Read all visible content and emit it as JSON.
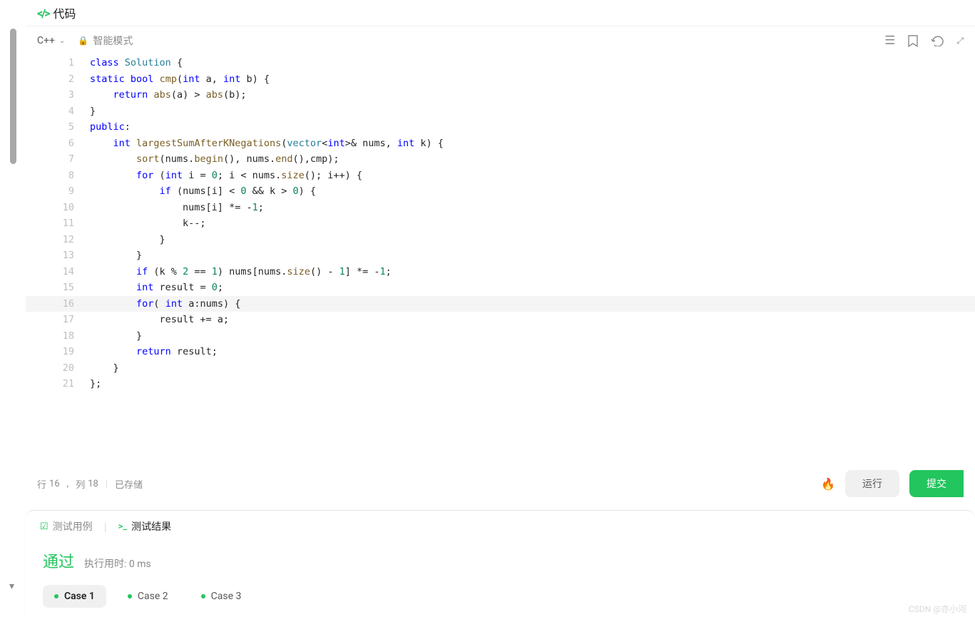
{
  "header": {
    "title": "代码"
  },
  "toolbar": {
    "language": "C++",
    "mode": "智能模式"
  },
  "code": {
    "lines": [
      {
        "n": 1,
        "html": "<span class='kw'>class</span> <span class='cls'>Solution</span> {"
      },
      {
        "n": 2,
        "html": "<span class='kw'>static</span> <span class='kw'>bool</span> <span class='fn'>cmp</span>(<span class='kw'>int</span> a, <span class='kw'>int</span> b) {"
      },
      {
        "n": 3,
        "html": "    <span class='kw'>return</span> <span class='fn'>abs</span>(a) > <span class='fn'>abs</span>(b);"
      },
      {
        "n": 4,
        "html": "}"
      },
      {
        "n": 5,
        "html": "<span class='kw'>public</span>:"
      },
      {
        "n": 6,
        "html": "    <span class='kw'>int</span> <span class='fn'>largestSumAfterKNegations</span>(<span class='type'>vector</span>&lt;<span class='kw'>int</span>&gt;&amp; nums, <span class='kw'>int</span> k) {"
      },
      {
        "n": 7,
        "html": "        <span class='fn'>sort</span>(nums.<span class='fn'>begin</span>(), nums.<span class='fn'>end</span>(),cmp);"
      },
      {
        "n": 8,
        "html": "        <span class='kw'>for</span> (<span class='kw'>int</span> i = <span class='num'>0</span>; i &lt; nums.<span class='fn'>size</span>(); i++) {"
      },
      {
        "n": 9,
        "html": "            <span class='kw'>if</span> (nums[i] &lt; <span class='num'>0</span> &amp;&amp; k &gt; <span class='num'>0</span>) {"
      },
      {
        "n": 10,
        "html": "                nums[i] *= -<span class='num'>1</span>;"
      },
      {
        "n": 11,
        "html": "                k--;"
      },
      {
        "n": 12,
        "html": "            }"
      },
      {
        "n": 13,
        "html": "        }"
      },
      {
        "n": 14,
        "html": "        <span class='kw'>if</span> (k % <span class='num'>2</span> == <span class='num'>1</span>) nums[nums.<span class='fn'>size</span>() - <span class='num'>1</span>] *= -<span class='num'>1</span>;"
      },
      {
        "n": 15,
        "html": "        <span class='kw'>int</span> result = <span class='num'>0</span>;"
      },
      {
        "n": 16,
        "html": "        <span class='kw'>for</span>( <span class='kw'>int</span> a:nums) {",
        "hl": true
      },
      {
        "n": 17,
        "html": "            result += a;"
      },
      {
        "n": 18,
        "html": "        }"
      },
      {
        "n": 19,
        "html": "        <span class='kw'>return</span> result;"
      },
      {
        "n": 20,
        "html": "    }"
      },
      {
        "n": 21,
        "html": "};"
      }
    ]
  },
  "status": {
    "cursor_row_label": "行",
    "cursor_row": 16,
    "cursor_col_label": "列",
    "cursor_col": 18,
    "saved": "已存储",
    "run": "运行",
    "submit": "提交"
  },
  "results": {
    "tabs": {
      "cases": "测试用例",
      "result": "测试结果"
    },
    "pass": "通过",
    "timing_label": "执行用时:",
    "timing_value": "0 ms",
    "cases": [
      {
        "label": "Case 1",
        "active": true
      },
      {
        "label": "Case 2"
      },
      {
        "label": "Case 3"
      }
    ]
  },
  "watermark": "CSDN @亦小河"
}
